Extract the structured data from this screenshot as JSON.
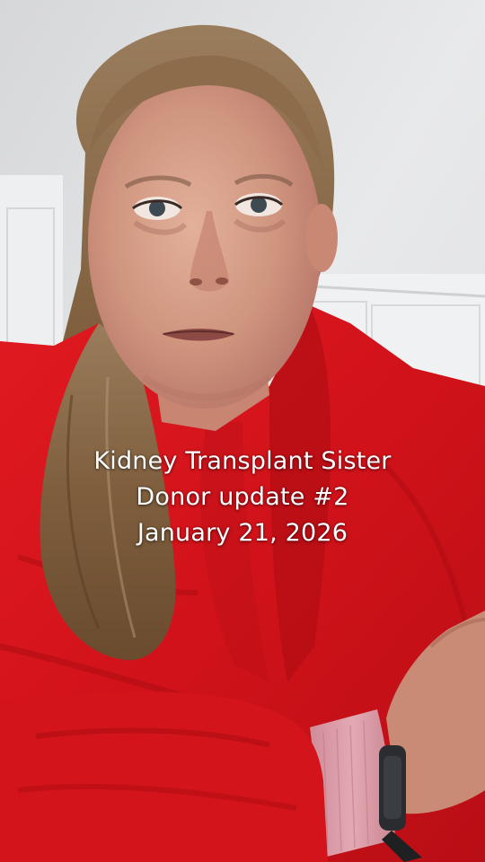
{
  "caption": {
    "lines": [
      "Kidney Transplant Sister",
      "Donor update #2",
      "January 21, 2026"
    ]
  },
  "colors": {
    "ceiling": "#e4e5e6",
    "cabinet": "#eeeff0",
    "robe": "#d8141a",
    "robe_shadow": "#9e0c12",
    "hair": "#8b6a45",
    "skin": "#d39a84",
    "cuff": "#d99aa5",
    "watch": "#2a2c2f"
  }
}
